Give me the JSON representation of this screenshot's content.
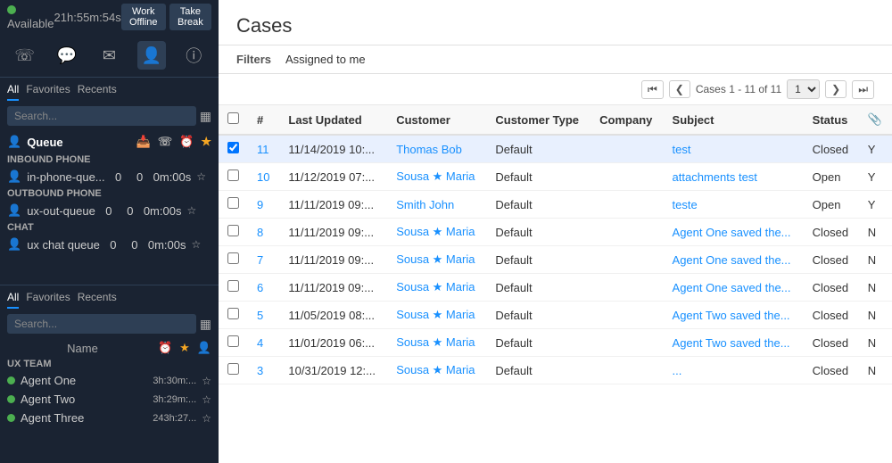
{
  "sidebar": {
    "status": "Available",
    "status_color": "#4caf50",
    "timer": "21h:55m:54s",
    "buttons": {
      "work_offline": "Work Offline",
      "take_break": "Take Break"
    },
    "nav_icons": [
      "person-phone",
      "chat",
      "email",
      "person-active",
      "info"
    ],
    "top_tabs": [
      "All",
      "Favorites",
      "Recents"
    ],
    "search_placeholder": "Search...",
    "queue": {
      "label": "Queue",
      "sections": [
        {
          "label": "INBOUND PHONE",
          "rows": [
            {
              "name": "in-phone-que...",
              "c1": 0,
              "c2": 0,
              "time": "0m:00s"
            }
          ]
        },
        {
          "label": "OUTBOUND PHONE",
          "rows": [
            {
              "name": "ux-out-queue",
              "c1": 0,
              "c2": 0,
              "time": "0m:00s"
            }
          ]
        },
        {
          "label": "CHAT",
          "rows": [
            {
              "name": "ux chat queue",
              "c1": 0,
              "c2": 0,
              "time": "0m:00s"
            }
          ]
        }
      ]
    },
    "bottom_tabs": [
      "All",
      "Favorites",
      "Recents"
    ],
    "agent_search_placeholder": "Search...",
    "team_label": "UX TEAM",
    "agents": [
      {
        "name": "Agent One",
        "time": "3h:30m:...",
        "status": "available"
      },
      {
        "name": "Agent Two",
        "time": "3h:29m:...",
        "status": "available"
      },
      {
        "name": "Agent Three",
        "time": "243h:27...",
        "status": "available"
      }
    ],
    "agent_col_label": "Name"
  },
  "main": {
    "title": "Cases",
    "filter_label": "Filters",
    "filter_value": "Assigned to me",
    "pagination": {
      "text": "Cases 1 - 11 of 11",
      "page": "1"
    },
    "table": {
      "columns": [
        "",
        "#",
        "Last Updated",
        "Customer",
        "Customer Type",
        "Company",
        "Subject",
        "Status",
        ""
      ],
      "rows": [
        {
          "id": "11",
          "last_updated": "11/14/2019 10:...",
          "customer": "Thomas Bob",
          "customer_type": "Default",
          "company": "",
          "subject": "test",
          "status": "Closed",
          "flag": "Y",
          "selected": true
        },
        {
          "id": "10",
          "last_updated": "11/12/2019 07:...",
          "customer": "Sousa ★ Maria",
          "customer_type": "Default",
          "company": "",
          "subject": "attachments test",
          "status": "Open",
          "flag": "Y",
          "selected": false
        },
        {
          "id": "9",
          "last_updated": "11/11/2019 09:...",
          "customer": "Smith John",
          "customer_type": "Default",
          "company": "",
          "subject": "teste",
          "status": "Open",
          "flag": "Y",
          "selected": false
        },
        {
          "id": "8",
          "last_updated": "11/11/2019 09:...",
          "customer": "Sousa ★ Maria",
          "customer_type": "Default",
          "company": "",
          "subject": "Agent One saved the...",
          "status": "Closed",
          "flag": "N",
          "selected": false
        },
        {
          "id": "7",
          "last_updated": "11/11/2019 09:...",
          "customer": "Sousa ★ Maria",
          "customer_type": "Default",
          "company": "",
          "subject": "Agent One saved the...",
          "status": "Closed",
          "flag": "N",
          "selected": false
        },
        {
          "id": "6",
          "last_updated": "11/11/2019 09:...",
          "customer": "Sousa ★ Maria",
          "customer_type": "Default",
          "company": "",
          "subject": "Agent One saved the...",
          "status": "Closed",
          "flag": "N",
          "selected": false
        },
        {
          "id": "5",
          "last_updated": "11/05/2019 08:...",
          "customer": "Sousa ★ Maria",
          "customer_type": "Default",
          "company": "",
          "subject": "Agent Two saved the...",
          "status": "Closed",
          "flag": "N",
          "selected": false
        },
        {
          "id": "4",
          "last_updated": "11/01/2019 06:...",
          "customer": "Sousa ★ Maria",
          "customer_type": "Default",
          "company": "",
          "subject": "Agent Two saved the...",
          "status": "Closed",
          "flag": "N",
          "selected": false
        },
        {
          "id": "3",
          "last_updated": "10/31/2019 12:...",
          "customer": "Sousa ★ Maria",
          "customer_type": "Default",
          "company": "",
          "subject": "...",
          "status": "Closed",
          "flag": "N",
          "selected": false
        }
      ]
    }
  }
}
